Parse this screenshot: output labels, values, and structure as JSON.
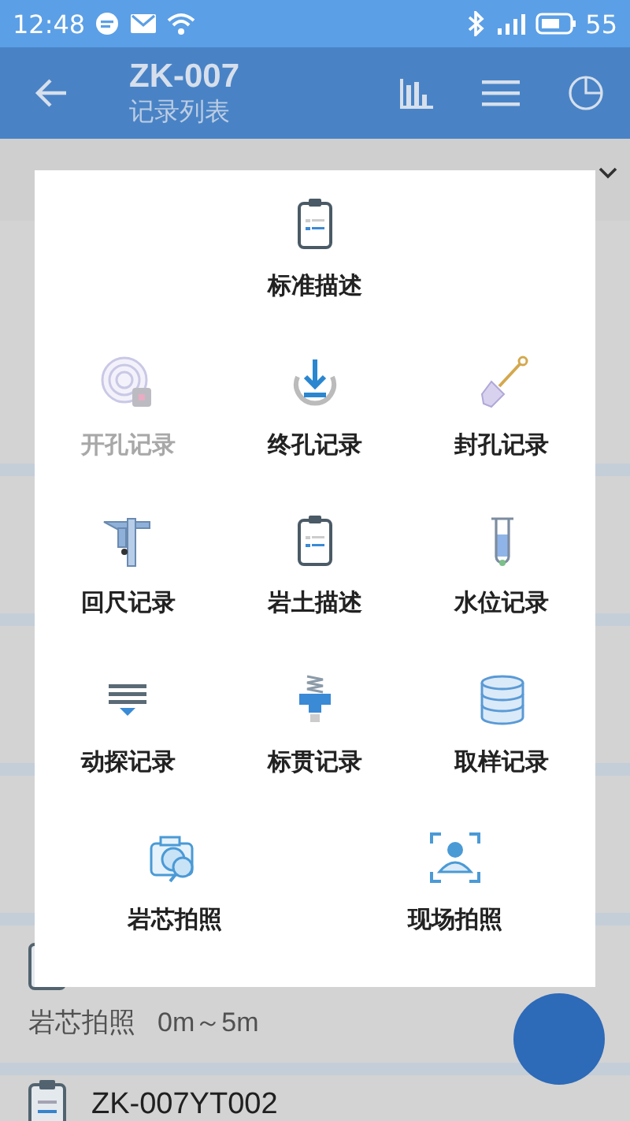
{
  "status_bar": {
    "time": "12:48",
    "battery": "55"
  },
  "header": {
    "title": "ZK-007",
    "subtitle": "记录列表"
  },
  "list": [
    {
      "title": "岩芯拍照",
      "range": "0m～5m"
    },
    {
      "title": "ZK-007YT002"
    }
  ],
  "menu": {
    "rows": [
      {
        "items": [
          {
            "label": "标准描述",
            "disabled": false
          }
        ]
      },
      {
        "items": [
          {
            "label": "开孔记录",
            "disabled": true
          },
          {
            "label": "终孔记录",
            "disabled": false
          },
          {
            "label": "封孔记录",
            "disabled": false
          }
        ]
      },
      {
        "items": [
          {
            "label": "回尺记录",
            "disabled": false
          },
          {
            "label": "岩土描述",
            "disabled": false
          },
          {
            "label": "水位记录",
            "disabled": false
          }
        ]
      },
      {
        "items": [
          {
            "label": "动探记录",
            "disabled": false
          },
          {
            "label": "标贯记录",
            "disabled": false
          },
          {
            "label": "取样记录",
            "disabled": false
          }
        ]
      },
      {
        "items": [
          {
            "label": "岩芯拍照",
            "disabled": false
          },
          {
            "label": "现场拍照",
            "disabled": false
          }
        ]
      }
    ]
  }
}
